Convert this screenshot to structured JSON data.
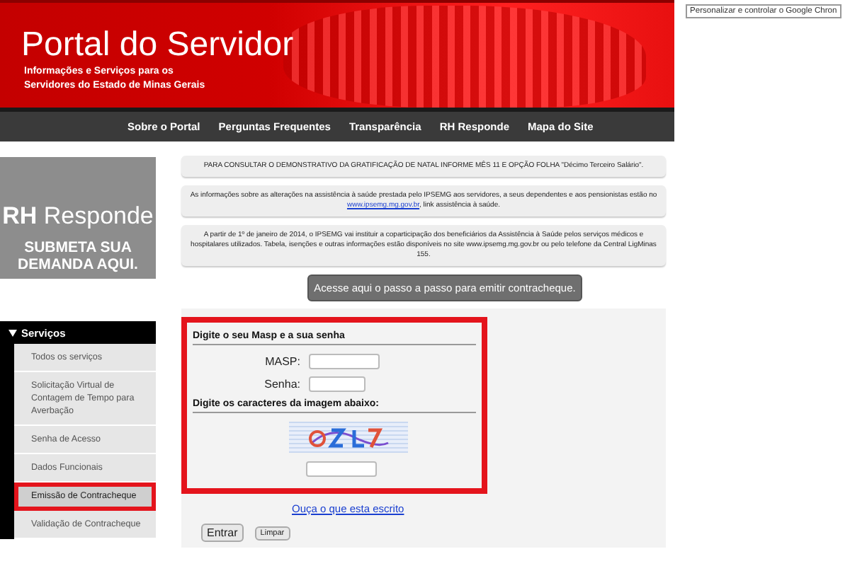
{
  "header": {
    "title": "Portal do Servidor",
    "subtitle_lines": [
      "Informações e Serviços para os",
      "Servidores do Estado de Minas Gerais"
    ]
  },
  "nav": [
    "Sobre o Portal",
    "Perguntas Frequentes",
    "Transparência",
    "RH Responde",
    "Mapa do Site"
  ],
  "rh_banner": {
    "title_bold": "RH",
    "title_rest": "Responde",
    "cta_lines": [
      "SUBMETA SUA",
      "DEMANDA AQUI."
    ]
  },
  "sidebar": {
    "heading": "Serviços",
    "expanded": true,
    "items": [
      {
        "label": "Todos os serviços",
        "selected": false,
        "highlighted": false
      },
      {
        "label": "Solicitação Virtual de Contagem de Tempo para Averbação",
        "selected": false,
        "highlighted": false
      },
      {
        "label": "Senha de Acesso",
        "selected": false,
        "highlighted": false
      },
      {
        "label": "Dados Funcionais",
        "selected": false,
        "highlighted": false
      },
      {
        "label": "Emissão de Contracheque",
        "selected": true,
        "highlighted": true
      },
      {
        "label": "Validação de Contracheque",
        "selected": false,
        "highlighted": false
      }
    ]
  },
  "notices": [
    {
      "kind": "plain",
      "text": "PARA CONSULTAR O DEMONSTRATIVO DA GRATIFICAÇÃO DE NATAL INFORME MÊS 11 E OPÇÃO FOLHA \"Décimo Terceiro Salário\"."
    },
    {
      "kind": "link",
      "before": "As informações sobre as alterações na assistência à saúde prestada pelo IPSEMG aos servidores, a seus dependentes e aos pensionistas estão no ",
      "link": "www.ipsemg.mg.gov.br",
      "after": ", link assistência à saúde."
    },
    {
      "kind": "plain",
      "text": "A partir de 1º de janeiro de 2014, o IPSEMG vai instituir a coparticipação dos beneficiários da Assistência à Saúde pelos serviços médicos e hospitalares utilizados. Tabela, isenções e outras informações estão disponíveis no site www.ipsemg.mg.gov.br ou pelo telefone da Central LigMinas 155."
    }
  ],
  "guide_button": "Acesse aqui o passo a passo para emitir contracheque.",
  "login_form": {
    "highlighted": true,
    "credentials_heading": "Digite o seu Masp e a sua senha",
    "fields": [
      {
        "label": "MASP:",
        "kind": "text"
      },
      {
        "label": "Senha:",
        "kind": "password"
      }
    ],
    "captcha_heading": "Digite os caracteres da imagem abaixo:",
    "audio_link": "Ouça o que esta escrito",
    "buttons": [
      {
        "label": "Entrar",
        "kind": "primary"
      },
      {
        "label": "Limpar",
        "kind": "small"
      }
    ]
  },
  "browser_tooltip": "Personalizar e controlar o Google Chron"
}
